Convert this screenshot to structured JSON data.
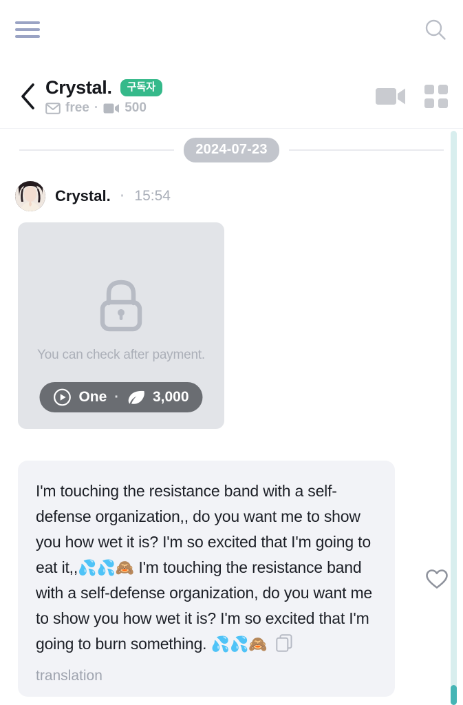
{
  "topbar": {
    "menu_icon": "hamburger-menu-icon",
    "search_icon": "search-icon"
  },
  "profile": {
    "back_icon": "chevron-left-icon",
    "name": "Crystal.",
    "badge": "구독자",
    "badge_color": "#35b98a",
    "mail_icon": "mail-icon",
    "plan": "free",
    "separator": "·",
    "video_icon": "video-camera-icon",
    "video_count": "500",
    "action_video_icon": "video-camera-icon",
    "action_grid_icon": "grid-icon"
  },
  "chat": {
    "date_divider": "2024-07-23",
    "message": {
      "avatar": "user-avatar",
      "sender": "Crystal.",
      "dot": "·",
      "time": "15:54",
      "locked_media": {
        "lock_icon": "lock-icon",
        "notice": "You can check after payment.",
        "play_icon": "play-circle-icon",
        "count_label": "One",
        "dot": "·",
        "currency_icon": "leaf-icon",
        "price": "3,000"
      },
      "body_text": "I'm touching the resistance band with a self-defense organization,, do you want me to show you how wet it is? I'm so excited that I'm going to eat it,,",
      "emoji_1": "💦💦🙈",
      "body_text_2": " I'm touching the resistance band with a self-defense organization, do you want me to show you how wet it is? I'm so excited that I'm going to burn something. ",
      "emoji_2": "💦💦🙈",
      "copy_icon": "copy-icon",
      "translation_label": "translation",
      "like_icon": "heart-outline-icon"
    }
  },
  "scrollbar": {
    "track_color": "#d8eeee",
    "thumb_color": "#46b5b5"
  }
}
